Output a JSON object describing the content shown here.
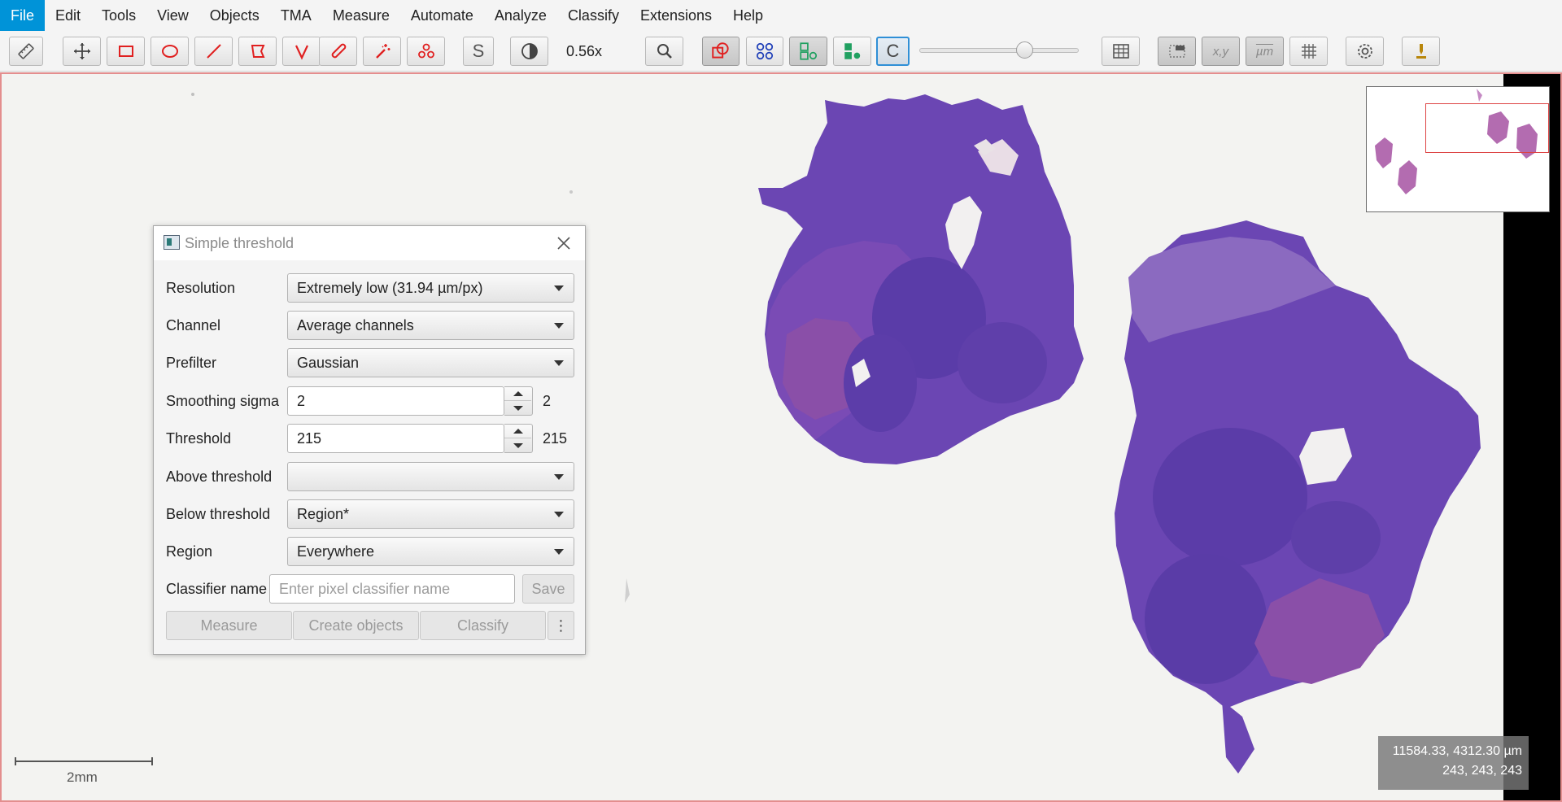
{
  "menu": {
    "items": [
      "File",
      "Edit",
      "Tools",
      "View",
      "Objects",
      "TMA",
      "Measure",
      "Automate",
      "Analyze",
      "Classify",
      "Extensions",
      "Help"
    ]
  },
  "toolbar": {
    "zoom": "0.56x",
    "icons": [
      "ruler-icon",
      "move-icon",
      "rectangle-icon",
      "ellipse-icon",
      "line-icon",
      "polygon-icon",
      "polyline-icon",
      "brush-icon",
      "wand-icon",
      "points-icon",
      "selection-mode-icon",
      "brightness-contrast-icon",
      "zoom-to-fit-icon",
      "show-annotations-icon",
      "show-tma-grid-icon",
      "show-detections-icon",
      "fill-detections-icon",
      "pixel-classification-icon",
      "opacity-slider",
      "measurement-table-icon",
      "overview-icon",
      "location-icon",
      "scalebar-icon",
      "grid-icon",
      "preferences-icon",
      "log-icon"
    ],
    "selection_mode_label": "S",
    "pixel_class_label": "C",
    "opacity_level": 0.66,
    "location_label": "x,y",
    "scalebar_label": "µm"
  },
  "viewer": {
    "scale_label": "2mm",
    "coords_um": "11584.33, 4312.30 µm",
    "coords_rgb": "243, 243, 243"
  },
  "dialog": {
    "title": "Simple threshold",
    "rows": [
      {
        "label": "Resolution",
        "value": "Extremely low (31.94 µm/px)"
      },
      {
        "label": "Channel",
        "value": "Average channels"
      },
      {
        "label": "Prefilter",
        "value": "Gaussian"
      },
      {
        "label": "Smoothing sigma",
        "value": "2",
        "display": "2"
      },
      {
        "label": "Threshold",
        "value": "215",
        "display": "215"
      },
      {
        "label": "Above threshold",
        "value": ""
      },
      {
        "label": "Below threshold",
        "value": "Region*"
      },
      {
        "label": "Region",
        "value": "Everywhere"
      }
    ],
    "classifier_label": "Classifier name",
    "classifier_placeholder": "Enter pixel classifier name",
    "save_label": "Save",
    "measure_label": "Measure",
    "create_objects_label": "Create objects",
    "classify_label": "Classify",
    "more_label": "⋮"
  },
  "colors": {
    "accent": "#0093d8",
    "tissue_purple": "#6e42b4",
    "tissue_pink": "#c46aa8",
    "viewer_border": "#e38e8e"
  }
}
